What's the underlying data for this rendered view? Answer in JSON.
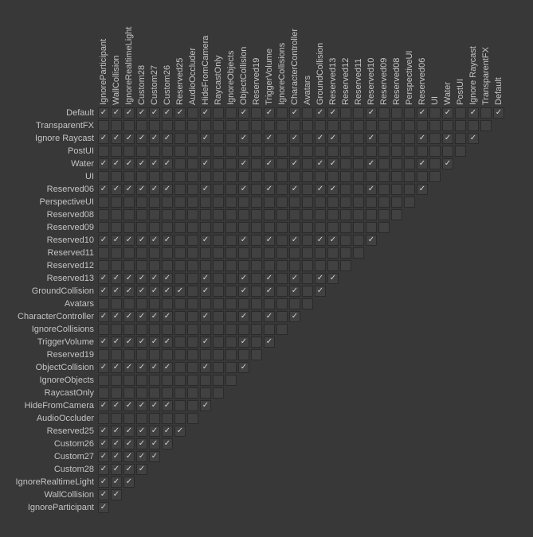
{
  "layers": [
    "Default",
    "TransparentFX",
    "Ignore Raycast",
    "PostUI",
    "Water",
    "UI",
    "Reserved06",
    "PerspectiveUI",
    "Reserved08",
    "Reserved09",
    "Reserved10",
    "Reserved11",
    "Reserved12",
    "Reserved13",
    "GroundCollision",
    "Avatars",
    "CharacterController",
    "IgnoreCollisions",
    "TriggerVolume",
    "Reserved19",
    "ObjectCollision",
    "IgnoreObjects",
    "RaycastOnly",
    "HideFromCamera",
    "AudioOccluder",
    "Reserved25",
    "Custom26",
    "Custom27",
    "Custom28",
    "IgnoreRealtimeLight",
    "WallCollision",
    "IgnoreParticipant"
  ],
  "cols": [
    "IgnoreParticipant",
    "WallCollision",
    "IgnoreRealtimeLight",
    "Custom28",
    "Custom27",
    "Custom26",
    "Reserved25",
    "AudioOccluder",
    "HideFromCamera",
    "RaycastOnly",
    "IgnoreObjects",
    "ObjectCollision",
    "Reserved19",
    "TriggerVolume",
    "IgnoreCollisions",
    "CharacterController",
    "Avatars",
    "GroundCollision",
    "Reserved13",
    "Reserved12",
    "Reserved11",
    "Reserved10",
    "Reserved09",
    "Reserved08",
    "PerspectiveUI",
    "Reserved06",
    "UI",
    "Water",
    "PostUI",
    "Ignore Raycast",
    "TransparentFX",
    "Default"
  ],
  "matrix": {
    "Default": [
      1,
      1,
      1,
      1,
      1,
      1,
      1,
      0,
      1,
      0,
      0,
      1,
      0,
      1,
      0,
      1,
      0,
      1,
      1,
      0,
      0,
      1,
      0,
      0,
      0,
      1,
      0,
      1,
      0,
      1,
      0,
      1
    ],
    "TransparentFX": [
      0,
      0,
      0,
      0,
      0,
      0,
      0,
      0,
      0,
      0,
      0,
      0,
      0,
      0,
      0,
      0,
      0,
      0,
      0,
      0,
      0,
      0,
      0,
      0,
      0,
      0,
      0,
      0,
      0,
      0,
      0
    ],
    "Ignore Raycast": [
      1,
      1,
      1,
      1,
      1,
      1,
      0,
      0,
      1,
      0,
      0,
      1,
      0,
      1,
      0,
      1,
      0,
      1,
      1,
      0,
      0,
      1,
      0,
      0,
      0,
      1,
      0,
      1,
      0,
      1
    ],
    "PostUI": [
      0,
      0,
      0,
      0,
      0,
      0,
      0,
      0,
      0,
      0,
      0,
      0,
      0,
      0,
      0,
      0,
      0,
      0,
      0,
      0,
      0,
      0,
      0,
      0,
      0,
      0,
      0,
      0,
      0
    ],
    "Water": [
      1,
      1,
      1,
      1,
      1,
      1,
      0,
      0,
      1,
      0,
      0,
      1,
      0,
      1,
      0,
      1,
      0,
      1,
      1,
      0,
      0,
      1,
      0,
      0,
      0,
      1,
      0,
      1
    ],
    "UI": [
      0,
      0,
      0,
      0,
      0,
      0,
      0,
      0,
      0,
      0,
      0,
      0,
      0,
      0,
      0,
      0,
      0,
      0,
      0,
      0,
      0,
      0,
      0,
      0,
      0,
      0,
      0
    ],
    "Reserved06": [
      1,
      1,
      1,
      1,
      1,
      1,
      0,
      0,
      1,
      0,
      0,
      1,
      0,
      1,
      0,
      1,
      0,
      1,
      1,
      0,
      0,
      1,
      0,
      0,
      0,
      1
    ],
    "PerspectiveUI": [
      0,
      0,
      0,
      0,
      0,
      0,
      0,
      0,
      0,
      0,
      0,
      0,
      0,
      0,
      0,
      0,
      0,
      0,
      0,
      0,
      0,
      0,
      0,
      0,
      0
    ],
    "Reserved08": [
      0,
      0,
      0,
      0,
      0,
      0,
      0,
      0,
      0,
      0,
      0,
      0,
      0,
      0,
      0,
      0,
      0,
      0,
      0,
      0,
      0,
      0,
      0,
      0
    ],
    "Reserved09": [
      0,
      0,
      0,
      0,
      0,
      0,
      0,
      0,
      0,
      0,
      0,
      0,
      0,
      0,
      0,
      0,
      0,
      0,
      0,
      0,
      0,
      0,
      0
    ],
    "Reserved10": [
      1,
      1,
      1,
      1,
      1,
      1,
      0,
      0,
      1,
      0,
      0,
      1,
      0,
      1,
      0,
      1,
      0,
      1,
      1,
      0,
      0,
      1
    ],
    "Reserved11": [
      0,
      0,
      0,
      0,
      0,
      0,
      0,
      0,
      0,
      0,
      0,
      0,
      0,
      0,
      0,
      0,
      0,
      0,
      0,
      0,
      0
    ],
    "Reserved12": [
      0,
      0,
      0,
      0,
      0,
      0,
      0,
      0,
      0,
      0,
      0,
      0,
      0,
      0,
      0,
      0,
      0,
      0,
      0,
      0
    ],
    "Reserved13": [
      1,
      1,
      1,
      1,
      1,
      1,
      0,
      0,
      1,
      0,
      0,
      1,
      0,
      1,
      0,
      1,
      0,
      1,
      1
    ],
    "GroundCollision": [
      1,
      1,
      1,
      1,
      1,
      1,
      1,
      0,
      1,
      0,
      0,
      1,
      0,
      1,
      0,
      1,
      0,
      1
    ],
    "Avatars": [
      0,
      0,
      0,
      0,
      0,
      0,
      0,
      0,
      0,
      0,
      0,
      0,
      0,
      0,
      0,
      0,
      0
    ],
    "CharacterController": [
      1,
      1,
      1,
      1,
      1,
      1,
      0,
      0,
      1,
      0,
      0,
      1,
      0,
      1,
      0,
      1
    ],
    "IgnoreCollisions": [
      0,
      0,
      0,
      0,
      0,
      0,
      0,
      0,
      0,
      0,
      0,
      0,
      0,
      0,
      0
    ],
    "TriggerVolume": [
      1,
      1,
      1,
      1,
      1,
      1,
      0,
      0,
      1,
      0,
      0,
      1,
      0,
      1
    ],
    "Reserved19": [
      0,
      0,
      0,
      0,
      0,
      0,
      0,
      0,
      0,
      0,
      0,
      0,
      0
    ],
    "ObjectCollision": [
      1,
      1,
      1,
      1,
      1,
      1,
      0,
      0,
      1,
      0,
      0,
      1
    ],
    "IgnoreObjects": [
      0,
      0,
      0,
      0,
      0,
      0,
      0,
      0,
      0,
      0,
      0
    ],
    "RaycastOnly": [
      0,
      0,
      0,
      0,
      0,
      0,
      0,
      0,
      0,
      0
    ],
    "HideFromCamera": [
      1,
      1,
      1,
      1,
      1,
      1,
      0,
      0,
      1
    ],
    "AudioOccluder": [
      0,
      0,
      0,
      0,
      0,
      0,
      0,
      0
    ],
    "Reserved25": [
      1,
      1,
      1,
      1,
      1,
      1,
      1
    ],
    "Custom26": [
      1,
      1,
      1,
      1,
      1,
      1
    ],
    "Custom27": [
      1,
      1,
      1,
      1,
      1
    ],
    "Custom28": [
      1,
      1,
      1,
      1
    ],
    "IgnoreRealtimeLight": [
      1,
      1,
      1
    ],
    "WallCollision": [
      1,
      1
    ],
    "IgnoreParticipant": [
      1
    ]
  },
  "rowLabelWidth": 118,
  "cellSize": 16
}
